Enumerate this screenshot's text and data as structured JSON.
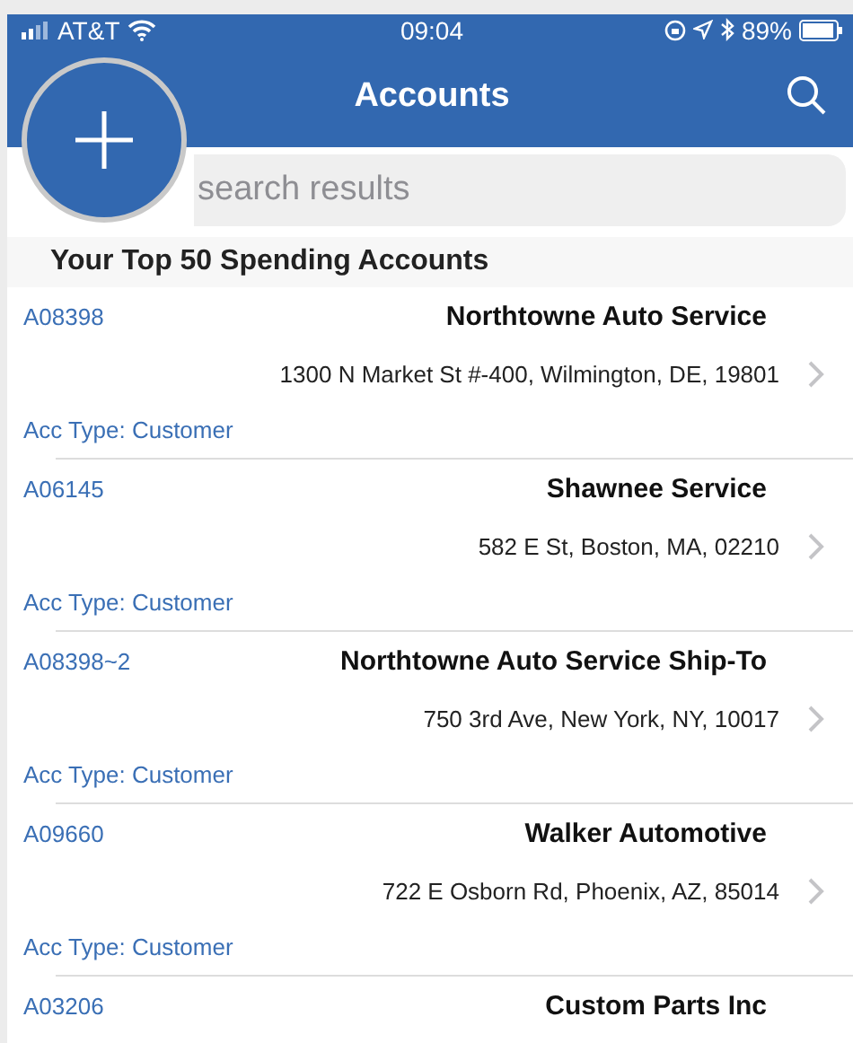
{
  "status_bar": {
    "carrier": "AT&T",
    "time": "09:04",
    "battery": "89%"
  },
  "nav": {
    "title": "Accounts"
  },
  "search": {
    "placeholder": "search results"
  },
  "section": {
    "title": "Your Top 50 Spending Accounts"
  },
  "accounts": [
    {
      "id": "A08398",
      "name": "Northtowne Auto Service",
      "address": "1300 N Market St #-400, Wilmington, DE, 19801",
      "type": "Acc Type: Customer"
    },
    {
      "id": "A06145",
      "name": "Shawnee Service",
      "address": "582 E St, Boston, MA, 02210",
      "type": "Acc Type: Customer"
    },
    {
      "id": "A08398~2",
      "name": "Northtowne Auto Service Ship-To",
      "address": "750 3rd Ave, New York, NY, 10017",
      "type": "Acc Type: Customer"
    },
    {
      "id": "A09660",
      "name": "Walker Automotive",
      "address": "722 E Osborn Rd, Phoenix, AZ, 85014",
      "type": "Acc Type: Customer"
    },
    {
      "id": "A03206",
      "name": "Custom Parts Inc"
    }
  ]
}
